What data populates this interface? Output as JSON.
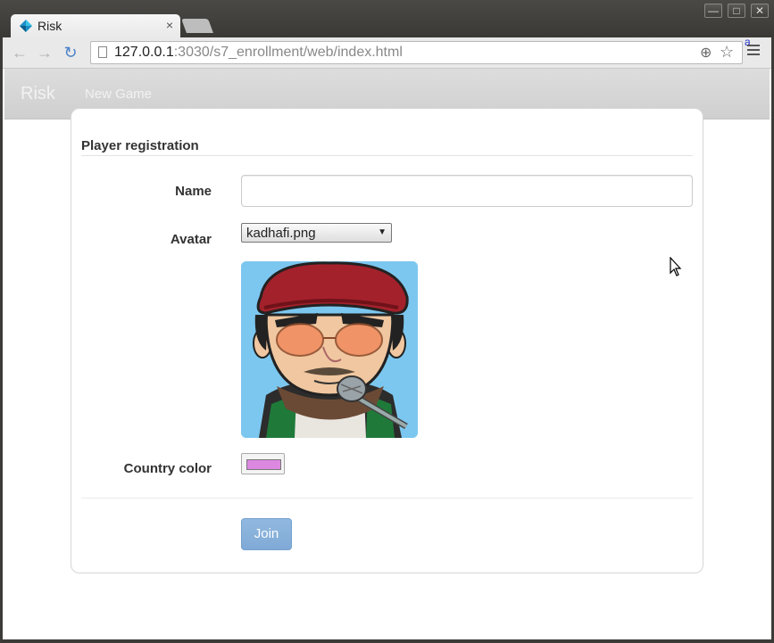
{
  "browser": {
    "tab_title": "Risk",
    "tab_close": "×",
    "url_host": "127.0.0.1",
    "url_rest": ":3030/s7_enrollment/web/index.html",
    "window_buttons": [
      "—",
      "□",
      "✕"
    ],
    "extension_label": "a"
  },
  "navbar": {
    "brand": "Risk",
    "new_game": "New Game"
  },
  "form": {
    "legend": "Player registration",
    "name_label": "Name",
    "name_value": "",
    "avatar_label": "Avatar",
    "avatar_selected": "kadhafi.png",
    "country_color_label": "Country color",
    "country_color_value": "#dd88e0",
    "join_label": "Join"
  },
  "colors": {
    "join_button": "#7aa6d4",
    "avatar_background": "#7cc7ef",
    "navbar_bg": "#d5d5d5"
  }
}
